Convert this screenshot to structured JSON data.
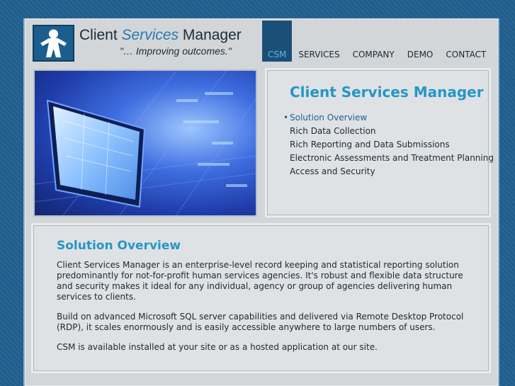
{
  "header": {
    "logo_name_part1": "Client ",
    "logo_name_part2": "Services",
    "logo_name_part3": " Manager",
    "tagline": "\"… Improving outcomes.\""
  },
  "nav": {
    "items": [
      {
        "label": "CSM",
        "active": true
      },
      {
        "label": "SERVICES"
      },
      {
        "label": "COMPANY"
      },
      {
        "label": "DEMO"
      },
      {
        "label": "CONTACT"
      }
    ]
  },
  "sidebar": {
    "title": "Client Services Manager",
    "items": [
      {
        "label": "Solution Overview",
        "active": true
      },
      {
        "label": "Rich Data Collection"
      },
      {
        "label": "Rich Reporting and Data Submissions"
      },
      {
        "label": "Electronic Assessments and Treatment Planning"
      },
      {
        "label": "Access and Security"
      }
    ]
  },
  "main": {
    "title": "Solution Overview",
    "paragraphs": [
      "Client Services Manager is an enterprise-level record keeping and statistical reporting solution predominantly for not-for-profit human services agencies. It's robust and flexible data structure and security makes it ideal for any individual, agency or group of agencies delivering human services to clients.",
      "Build on advanced Microsoft SQL server capabilities and delivered via Remote Desktop Protocol (RDP), it scales enormously and is easily accessible anywhere to large numbers of users.",
      "CSM is available installed at your site or as a hosted application at our site."
    ]
  },
  "colors": {
    "accent": "#2596c6",
    "nav_active_bg": "#1c4f78",
    "nav_active_text": "#58b6e6",
    "brand_blue": "#1b5e8e"
  }
}
